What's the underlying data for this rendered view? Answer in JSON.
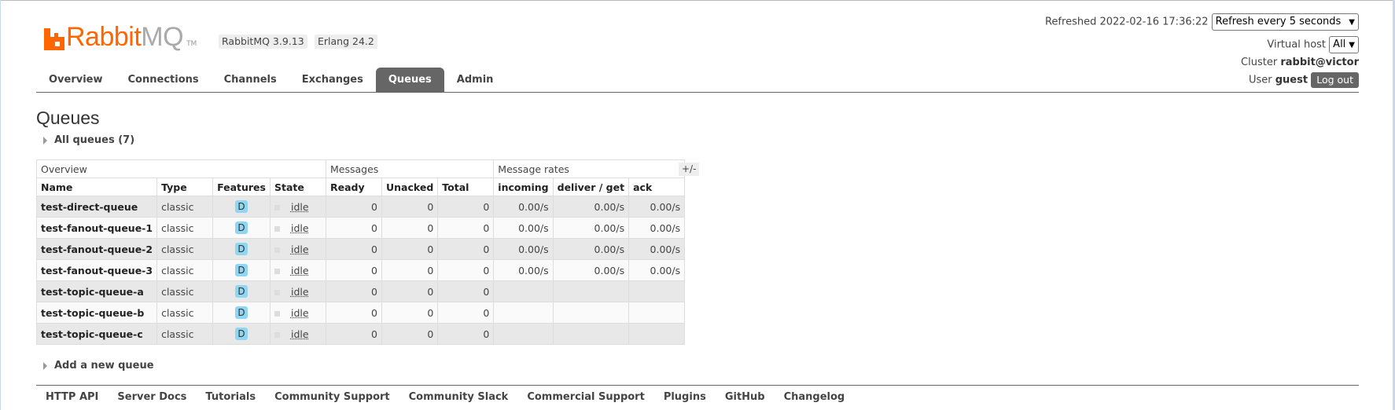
{
  "logo": {
    "brand_part1": "Rabbit",
    "brand_part2": "MQ",
    "tm": "TM",
    "color": "#ff6600"
  },
  "versions": {
    "rabbitmq": "RabbitMQ 3.9.13",
    "erlang": "Erlang 24.2"
  },
  "top_right": {
    "refreshed_label": "Refreshed 2022-02-16 17:36:22",
    "refresh_option": "Refresh every 5 seconds",
    "vhost_label": "Virtual host",
    "vhost_value": "All",
    "cluster_label": "Cluster",
    "cluster_value": "rabbit@victor",
    "user_label": "User",
    "user_value": "guest",
    "logout": "Log out"
  },
  "tabs": [
    {
      "label": "Overview"
    },
    {
      "label": "Connections"
    },
    {
      "label": "Channels"
    },
    {
      "label": "Exchanges"
    },
    {
      "label": "Queues",
      "active": true
    },
    {
      "label": "Admin"
    }
  ],
  "page_title": "Queues",
  "all_queues_label": "All queues (7)",
  "table": {
    "groups": {
      "overview": "Overview",
      "messages": "Messages",
      "rates": "Message rates"
    },
    "plus_minus": "+/-",
    "columns": [
      "Name",
      "Type",
      "Features",
      "State",
      "Ready",
      "Unacked",
      "Total",
      "incoming",
      "deliver / get",
      "ack"
    ],
    "rows": [
      {
        "name": "test-direct-queue",
        "type": "classic",
        "feature": "D",
        "state": "idle",
        "ready": "0",
        "unacked": "0",
        "total": "0",
        "incoming": "0.00/s",
        "deliver": "0.00/s",
        "ack": "0.00/s"
      },
      {
        "name": "test-fanout-queue-1",
        "type": "classic",
        "feature": "D",
        "state": "idle",
        "ready": "0",
        "unacked": "0",
        "total": "0",
        "incoming": "0.00/s",
        "deliver": "0.00/s",
        "ack": "0.00/s"
      },
      {
        "name": "test-fanout-queue-2",
        "type": "classic",
        "feature": "D",
        "state": "idle",
        "ready": "0",
        "unacked": "0",
        "total": "0",
        "incoming": "0.00/s",
        "deliver": "0.00/s",
        "ack": "0.00/s"
      },
      {
        "name": "test-fanout-queue-3",
        "type": "classic",
        "feature": "D",
        "state": "idle",
        "ready": "0",
        "unacked": "0",
        "total": "0",
        "incoming": "0.00/s",
        "deliver": "0.00/s",
        "ack": "0.00/s"
      },
      {
        "name": "test-topic-queue-a",
        "type": "classic",
        "feature": "D",
        "state": "idle",
        "ready": "0",
        "unacked": "0",
        "total": "0",
        "incoming": "",
        "deliver": "",
        "ack": ""
      },
      {
        "name": "test-topic-queue-b",
        "type": "classic",
        "feature": "D",
        "state": "idle",
        "ready": "0",
        "unacked": "0",
        "total": "0",
        "incoming": "",
        "deliver": "",
        "ack": ""
      },
      {
        "name": "test-topic-queue-c",
        "type": "classic",
        "feature": "D",
        "state": "idle",
        "ready": "0",
        "unacked": "0",
        "total": "0",
        "incoming": "",
        "deliver": "",
        "ack": ""
      }
    ]
  },
  "add_queue_label": "Add a new queue",
  "footer_links": [
    "HTTP API",
    "Server Docs",
    "Tutorials",
    "Community Support",
    "Community Slack",
    "Commercial Support",
    "Plugins",
    "GitHub",
    "Changelog"
  ]
}
